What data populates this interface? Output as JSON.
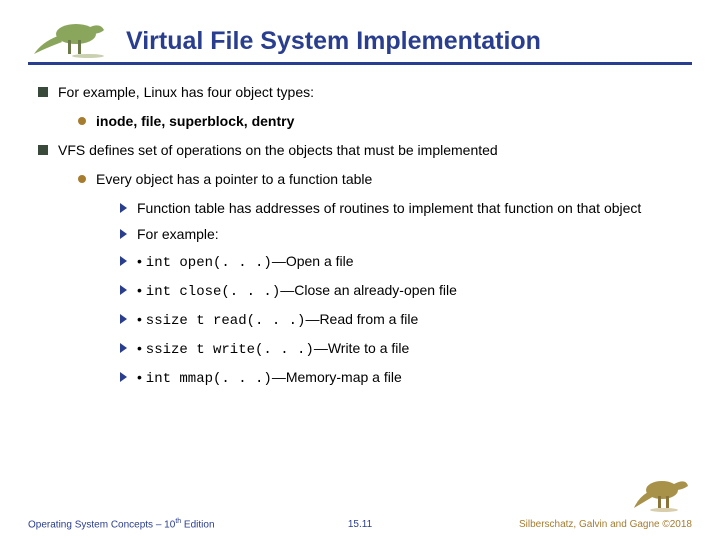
{
  "title": "Virtual File System Implementation",
  "bullets": {
    "b1": "For example, Linux has four object types:",
    "b1_1": "inode, file, superblock, dentry",
    "b2": "VFS defines set of operations on the objects that must be implemented",
    "b2_1": "Every object has a pointer to a function table",
    "b2_1_1": "Function table has addresses of routines to implement that function on that object",
    "b2_1_2": "For example:",
    "b2_1_3": "• int open(. . .)—Open a file",
    "b2_1_4": "• int close(. . .)—Close an already-open file",
    "b2_1_5": "• ssize t read(. . .)—Read from a file",
    "b2_1_6": "• ssize t write(. . .)—Write to a file",
    "b2_1_7": "• int mmap(. . .)—Memory-map a file"
  },
  "footer": {
    "left_pre": "Operating System Concepts – 10",
    "left_sup": "th",
    "left_post": " Edition",
    "center": "15.11",
    "right": "Silberschatz, Galvin and Gagne ©2018"
  }
}
